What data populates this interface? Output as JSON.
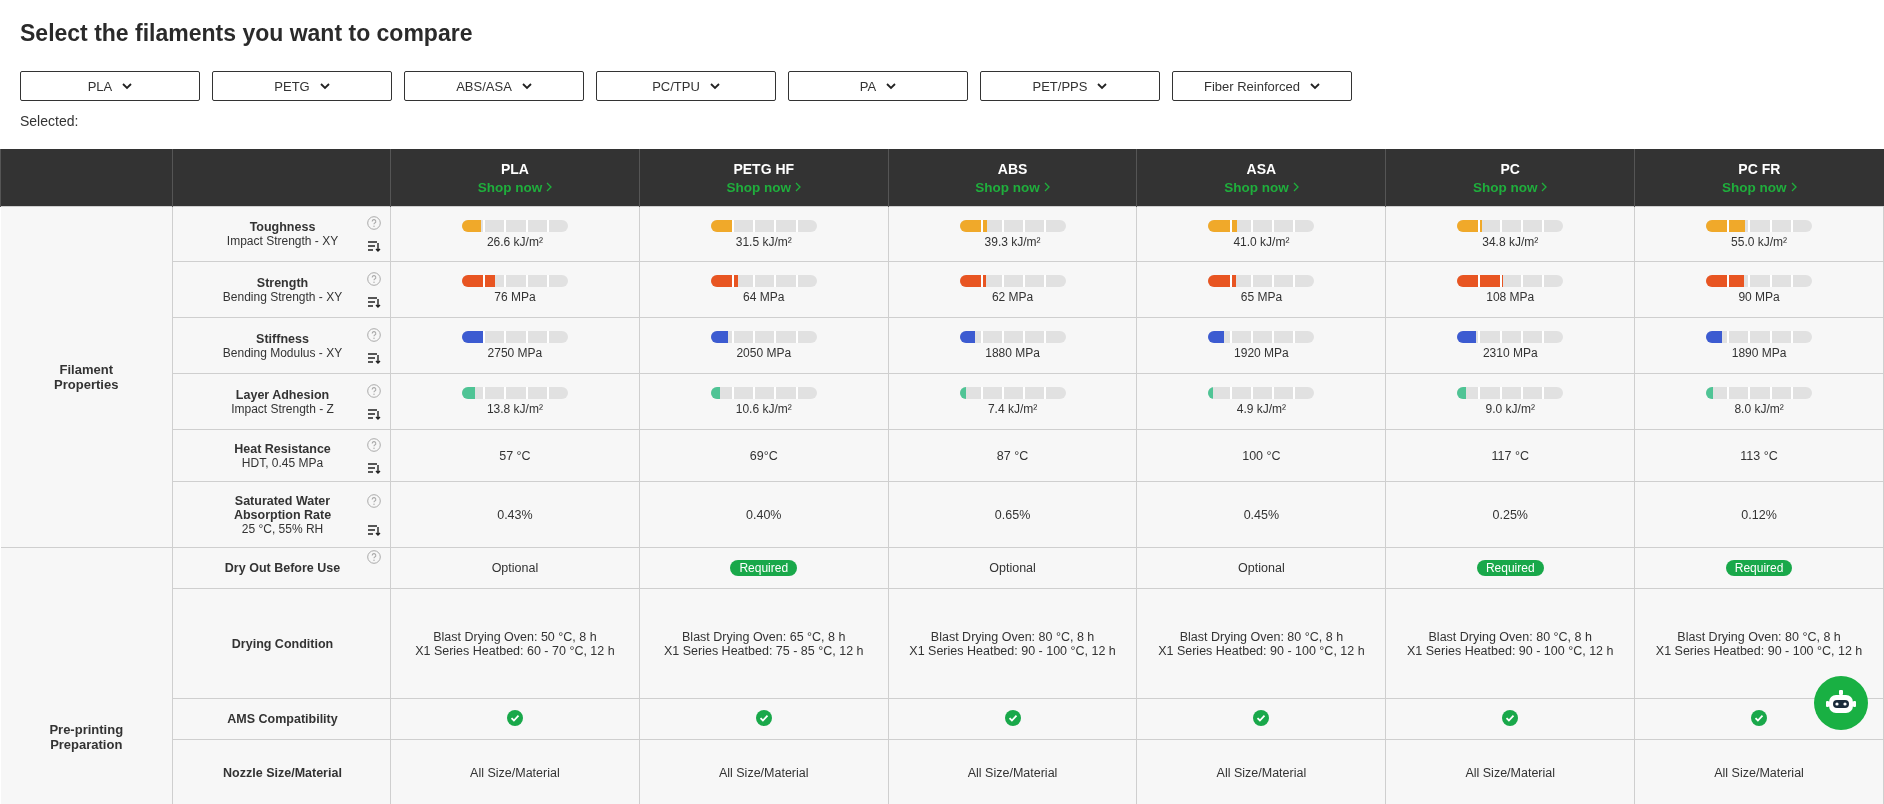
{
  "title": "Select the filaments you want to compare",
  "filters": [
    {
      "label": "PLA"
    },
    {
      "label": "PETG"
    },
    {
      "label": "ABS/ASA"
    },
    {
      "label": "PC/TPU"
    },
    {
      "label": "PA"
    },
    {
      "label": "PET/PPS"
    },
    {
      "label": "Fiber Reinforced"
    }
  ],
  "selected_label": "Selected:",
  "table": {
    "products": [
      {
        "name": "PLA",
        "link": "Shop now"
      },
      {
        "name": "PETG HF",
        "link": "Shop now"
      },
      {
        "name": "ABS",
        "link": "Shop now"
      },
      {
        "name": "ASA",
        "link": "Shop now"
      },
      {
        "name": "PC",
        "link": "Shop now"
      },
      {
        "name": "PC FR",
        "link": "Shop now"
      }
    ],
    "groups": [
      {
        "name": "Filament Properties",
        "rows": [
          {
            "kind": "meter",
            "label": "Toughness",
            "sublabel": "Impact Strength - XY",
            "help": true,
            "sortable": true,
            "color": "#f0a92a",
            "cells": [
              {
                "level": 0.18,
                "reading": "26.6 kJ/m²"
              },
              {
                "level": 0.21,
                "reading": "31.5 kJ/m²"
              },
              {
                "level": 0.26,
                "reading": "39.3 kJ/m²"
              },
              {
                "level": 0.27,
                "reading": "41.0 kJ/m²"
              },
              {
                "level": 0.23,
                "reading": "34.8 kJ/m²"
              },
              {
                "level": 0.37,
                "reading": "55.0 kJ/m²"
              }
            ]
          },
          {
            "kind": "meter",
            "label": "Strength",
            "sublabel": "Bending Strength - XY",
            "help": true,
            "sortable": true,
            "color": "#e85522",
            "cells": [
              {
                "level": 0.31,
                "reading": "76 MPa"
              },
              {
                "level": 0.26,
                "reading": "64 MPa"
              },
              {
                "level": 0.25,
                "reading": "62 MPa"
              },
              {
                "level": 0.26,
                "reading": "65 MPa"
              },
              {
                "level": 0.43,
                "reading": "108 MPa"
              },
              {
                "level": 0.36,
                "reading": "90 MPa"
              }
            ]
          },
          {
            "kind": "meter",
            "label": "Stiffness",
            "sublabel": "Bending Modulus - XY",
            "help": true,
            "sortable": true,
            "color": "#3c5bd1",
            "cells": [
              {
                "level": 0.22,
                "reading": "2750 MPa"
              },
              {
                "level": 0.16,
                "reading": "2050 MPa"
              },
              {
                "level": 0.15,
                "reading": "1880 MPa"
              },
              {
                "level": 0.15,
                "reading": "1920 MPa"
              },
              {
                "level": 0.18,
                "reading": "2310 MPa"
              },
              {
                "level": 0.15,
                "reading": "1890 MPa"
              }
            ]
          },
          {
            "kind": "meter",
            "label": "Layer Adhesion",
            "sublabel": "Impact Strength - Z",
            "help": true,
            "sortable": true,
            "color": "#4fc495",
            "cells": [
              {
                "level": 0.12,
                "reading": "13.8 kJ/m²"
              },
              {
                "level": 0.09,
                "reading": "10.6 kJ/m²"
              },
              {
                "level": 0.06,
                "reading": "7.4 kJ/m²"
              },
              {
                "level": 0.04,
                "reading": "4.9 kJ/m²"
              },
              {
                "level": 0.08,
                "reading": "9.0 kJ/m²"
              },
              {
                "level": 0.07,
                "reading": "8.0 kJ/m²"
              }
            ]
          },
          {
            "kind": "text",
            "label": "Heat Resistance",
            "sublabel": "HDT, 0.45 MPa",
            "help": true,
            "sortable": true,
            "cells": [
              {
                "text": "57 °C"
              },
              {
                "text": "69°C"
              },
              {
                "text": "87 °C"
              },
              {
                "text": "100 °C"
              },
              {
                "text": "117 °C"
              },
              {
                "text": "113 °C"
              }
            ]
          },
          {
            "kind": "text",
            "label": "Saturated Water Absorption Rate",
            "sublabel": "25 °C, 55% RH",
            "help": true,
            "sortable": true,
            "cells": [
              {
                "text": "0.43%"
              },
              {
                "text": "0.40%"
              },
              {
                "text": "0.65%"
              },
              {
                "text": "0.45%"
              },
              {
                "text": "0.25%"
              },
              {
                "text": "0.12%"
              }
            ]
          }
        ]
      },
      {
        "name": "Pre-printing Preparation",
        "rows": [
          {
            "kind": "status",
            "label": "Dry Out Before Use",
            "help": true,
            "sortable": false,
            "cells": [
              {
                "text": "Optional",
                "required": false
              },
              {
                "text": "Required",
                "required": true
              },
              {
                "text": "Optional",
                "required": false
              },
              {
                "text": "Optional",
                "required": false
              },
              {
                "text": "Required",
                "required": true
              },
              {
                "text": "Required",
                "required": true
              }
            ]
          },
          {
            "kind": "lines",
            "label": "Drying Condition",
            "help": false,
            "sortable": false,
            "cells": [
              {
                "lines": [
                  "Blast Drying Oven: 50 °C, 8 h",
                  "X1 Series Heatbed: 60 - 70 °C, 12 h"
                ]
              },
              {
                "lines": [
                  "Blast Drying Oven: 65 °C, 8 h",
                  "X1 Series Heatbed: 75 - 85 °C, 12 h"
                ]
              },
              {
                "lines": [
                  "Blast Drying Oven: 80 °C, 8 h",
                  "X1 Series Heatbed: 90 - 100 °C, 12 h"
                ]
              },
              {
                "lines": [
                  "Blast Drying Oven: 80 °C, 8 h",
                  "X1 Series Heatbed: 90 - 100 °C, 12 h"
                ]
              },
              {
                "lines": [
                  "Blast Drying Oven: 80 °C, 8 h",
                  "X1 Series Heatbed: 90 - 100 °C, 12 h"
                ]
              },
              {
                "lines": [
                  "Blast Drying Oven: 80 °C, 8 h",
                  "X1 Series Heatbed: 90 - 100 °C, 12 h"
                ]
              }
            ]
          },
          {
            "kind": "check",
            "label": "AMS Compatibility",
            "help": false,
            "sortable": false,
            "cells": [
              {
                "checked": true
              },
              {
                "checked": true
              },
              {
                "checked": true
              },
              {
                "checked": true
              },
              {
                "checked": true
              },
              {
                "checked": true
              }
            ]
          },
          {
            "kind": "text",
            "label": "Nozzle Size/Material",
            "help": false,
            "sortable": false,
            "cells": [
              {
                "text": "All Size/Material"
              },
              {
                "text": "All Size/Material"
              },
              {
                "text": "All Size/Material"
              },
              {
                "text": "All Size/Material"
              },
              {
                "text": "All Size/Material"
              },
              {
                "text": "All Size/Material"
              }
            ]
          }
        ]
      }
    ]
  }
}
